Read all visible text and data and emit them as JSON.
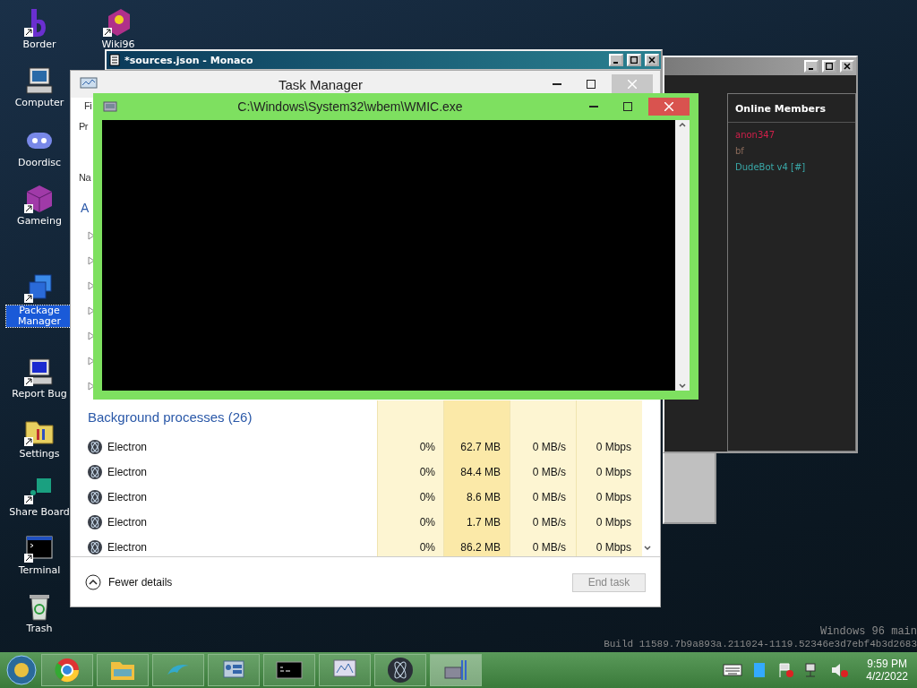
{
  "desktop_icons": [
    {
      "label": "Border",
      "selected": false,
      "shortcut": true
    },
    {
      "label": "Wiki96",
      "selected": false,
      "shortcut": true
    },
    {
      "label": "Computer",
      "selected": false,
      "shortcut": false
    },
    {
      "label": "Doordisc",
      "selected": false,
      "shortcut": false
    },
    {
      "label": "Gameing",
      "selected": false,
      "shortcut": true
    },
    {
      "label": "Package Manager",
      "selected": true,
      "shortcut": true
    },
    {
      "label": "Report Bug",
      "selected": false,
      "shortcut": true
    },
    {
      "label": "Settings",
      "selected": false,
      "shortcut": true
    },
    {
      "label": "Share Board",
      "selected": false,
      "shortcut": true
    },
    {
      "label": "Terminal",
      "selected": false,
      "shortcut": true
    },
    {
      "label": "Trash",
      "selected": false,
      "shortcut": false
    }
  ],
  "editor_window": {
    "title": "*sources.json - Monaco"
  },
  "chat_window": {
    "members_title": "Online Members",
    "members": [
      {
        "name": "anon347",
        "color": "#d0204a"
      },
      {
        "name": "bf",
        "color": "#8a6a5a"
      },
      {
        "name": "DudeBot v4 [#]",
        "color": "#3aa8a8"
      }
    ]
  },
  "task_manager": {
    "title": "Task Manager",
    "menu_fragment": "Fi",
    "tab_fragment": "Pr",
    "column_fragment": "Na",
    "group_fragment": "A",
    "background_header": "Background processes (26)",
    "processes": [
      {
        "name": "Electron",
        "cpu": "0%",
        "memory": "62.7 MB",
        "disk": "0 MB/s",
        "network": "0 Mbps"
      },
      {
        "name": "Electron",
        "cpu": "0%",
        "memory": "84.4 MB",
        "disk": "0 MB/s",
        "network": "0 Mbps"
      },
      {
        "name": "Electron",
        "cpu": "0%",
        "memory": "8.6 MB",
        "disk": "0 MB/s",
        "network": "0 Mbps"
      },
      {
        "name": "Electron",
        "cpu": "0%",
        "memory": "1.7 MB",
        "disk": "0 MB/s",
        "network": "0 Mbps"
      },
      {
        "name": "Electron",
        "cpu": "0%",
        "memory": "86.2 MB",
        "disk": "0 MB/s",
        "network": "0 Mbps"
      }
    ],
    "fewer_details": "Fewer details",
    "end_task": {
      "label": "End task",
      "disabled": true
    }
  },
  "console_window": {
    "title": "C:\\Windows\\System32\\wbem\\WMIC.exe"
  },
  "watermark": {
    "line_1": "Windows 96 main",
    "line_2": "Build 11589.7b9a893a.211024-1119.52346e3d7ebf4b3d2683"
  },
  "taskbar": {
    "time": "9:59 PM",
    "date": "4/2/2022"
  }
}
